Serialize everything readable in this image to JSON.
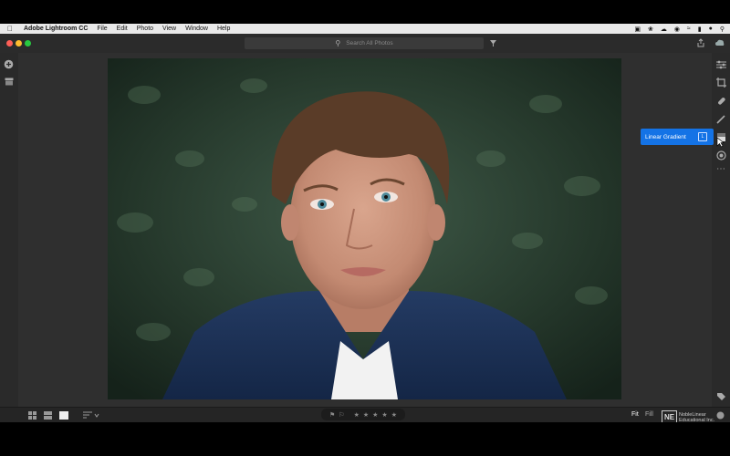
{
  "menubar": {
    "app_name": "Adobe Lightroom CC",
    "items": [
      "File",
      "Edit",
      "Photo",
      "View",
      "Window",
      "Help"
    ]
  },
  "search": {
    "placeholder": "Search All Photos"
  },
  "tooltip": {
    "label": "Linear Gradient",
    "shortcut": "L"
  },
  "bottombar": {
    "fit_label": "Fit",
    "fill_label": "Fill",
    "stars": 5
  },
  "watermark": {
    "text": "NobleLinear Educational Inc."
  },
  "colors": {
    "accent": "#1473e6",
    "panel": "#2b2b2b",
    "canvas": "#2f2f2f"
  }
}
